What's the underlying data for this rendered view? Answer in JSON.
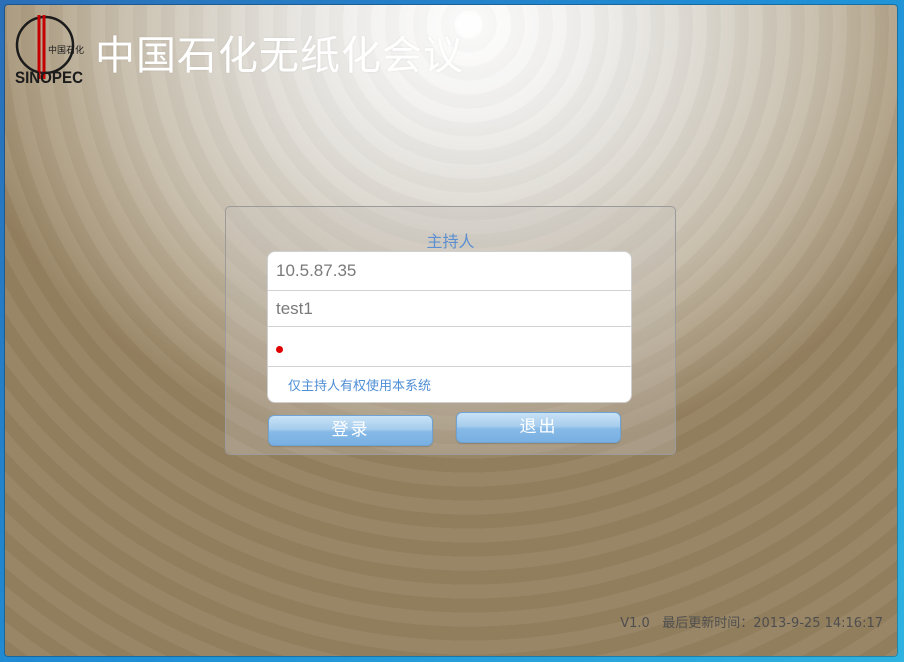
{
  "app": {
    "title": "中国石化无纸化会议",
    "logo_text": "中国石化",
    "logo_brand": "SINOPEC"
  },
  "login": {
    "role_title": "主持人",
    "server_value": "10.5.87.35",
    "username_value": "test1",
    "password_value": "",
    "hint": "仅主持人有权使用本系统",
    "login_label": "登录",
    "exit_label": "退出"
  },
  "footer": {
    "version": "V1.0",
    "update_label": "最后更新时间：2013-9-25  14:16:17"
  },
  "colors": {
    "accent_blue": "#5b8fd1",
    "button_blue": "#86b9e6",
    "password_dot": "#e00000"
  }
}
